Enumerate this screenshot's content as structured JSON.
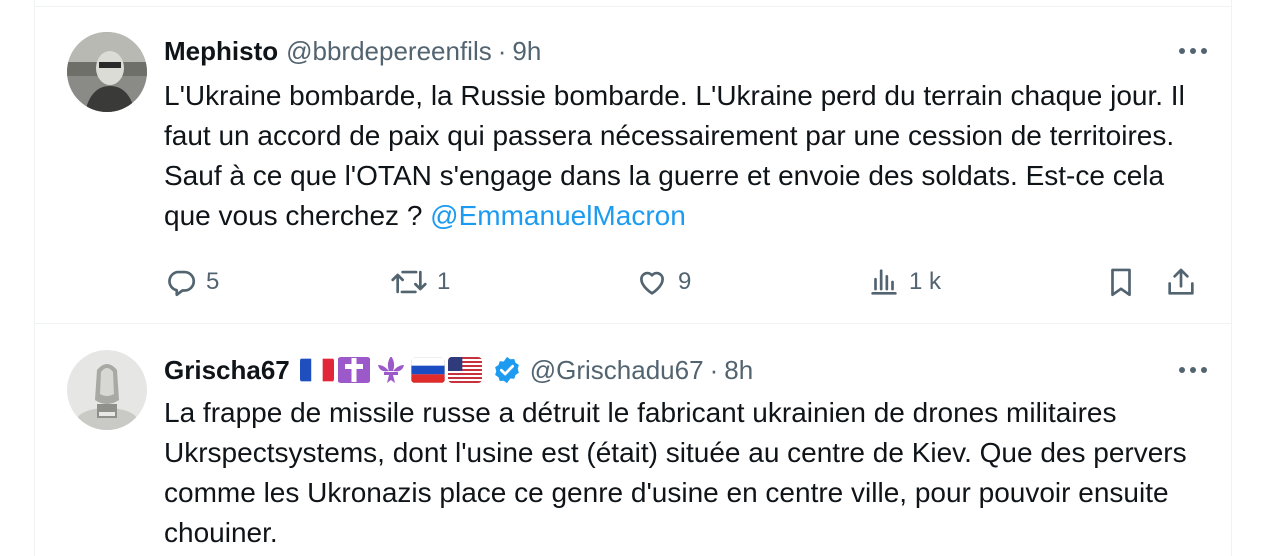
{
  "tweets": [
    {
      "name": "Mephisto",
      "handle": "@bbrdepereenfils",
      "separator": "·",
      "time": "9h",
      "text_before_mention": "L'Ukraine bombarde, la Russie bombarde. L'Ukraine perd du terrain chaque jour. Il faut un accord de paix qui passera nécessairement par une cession de territoires. Sauf à ce que l'OTAN s'engage dans la guerre et envoie des soldats. Est-ce cela que vous cherchez ? ",
      "mention": "@EmmanuelMacron",
      "replies": "5",
      "retweets": "1",
      "likes": "9",
      "views": "1 k",
      "icons": [
        "more-icon",
        "reply-icon",
        "retweet-icon",
        "like-icon",
        "views-icon",
        "bookmark-icon",
        "share-icon"
      ]
    },
    {
      "name": "Grischa67",
      "flags": [
        "flag-france",
        "latin-cross-emoji",
        "fleur-de-lis-emoji",
        "flag-russia",
        "flag-usa"
      ],
      "verified": true,
      "handle": "@Grischadu67",
      "separator": "·",
      "time": "8h",
      "text": "La frappe de missile russe a détruit le fabricant ukrainien de drones militaires Ukrspectsystems, dont l'usine  est (était) située au centre de Kiev. Que des pervers comme les Ukronazis place ce genre d'usine en centre ville, pour pouvoir ensuite chouiner."
    }
  ],
  "colors": {
    "text": "#0f1419",
    "secondary": "#536471",
    "accent": "#1d9bf0",
    "border": "#eff3f4"
  }
}
